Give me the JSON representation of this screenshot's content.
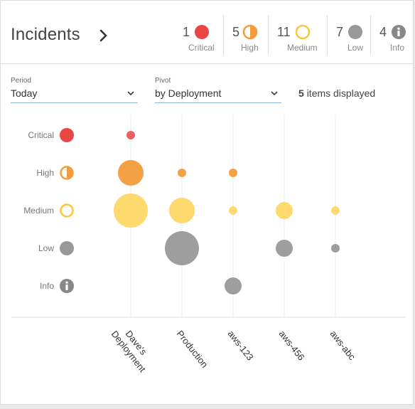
{
  "header": {
    "title": "Incidents",
    "counts": [
      {
        "key": "critical",
        "count": "1",
        "label": "Critical",
        "icon": "critical-icon"
      },
      {
        "key": "high",
        "count": "5",
        "label": "High",
        "icon": "high-icon"
      },
      {
        "key": "medium",
        "count": "11",
        "label": "Medium",
        "icon": "medium-icon"
      },
      {
        "key": "low",
        "count": "7",
        "label": "Low",
        "icon": "low-icon"
      },
      {
        "key": "info",
        "count": "4",
        "label": "Info",
        "icon": "info-icon"
      }
    ]
  },
  "controls": {
    "period": {
      "label": "Period",
      "value": "Today"
    },
    "pivot": {
      "label": "Pivot",
      "value": "by Deployment"
    },
    "items_count": "5",
    "items_text": "items displayed"
  },
  "colors": {
    "critical": "#e84545",
    "high": "#f39c3b",
    "medium": "#fdd766",
    "medium_ring": "#f7c93a",
    "low": "#999999",
    "info": "#888888",
    "divider": "#dcdcdc",
    "accent_line": "#8ab4d8"
  },
  "chart_data": {
    "type": "scatter",
    "rows": [
      "Critical",
      "High",
      "Medium",
      "Low",
      "Info"
    ],
    "categories": [
      "Dave's Deployment",
      "Production",
      "aws-123",
      "aws-456",
      "aws-abc"
    ],
    "points": [
      {
        "category": "Dave's Deployment",
        "severity": "Critical",
        "magnitude": 1
      },
      {
        "category": "Dave's Deployment",
        "severity": "High",
        "magnitude": 3
      },
      {
        "category": "Dave's Deployment",
        "severity": "Medium",
        "magnitude": 5
      },
      {
        "category": "Production",
        "severity": "High",
        "magnitude": 1
      },
      {
        "category": "Production",
        "severity": "Medium",
        "magnitude": 3
      },
      {
        "category": "Production",
        "severity": "Low",
        "magnitude": 5
      },
      {
        "category": "aws-123",
        "severity": "High",
        "magnitude": 1
      },
      {
        "category": "aws-123",
        "severity": "Medium",
        "magnitude": 1
      },
      {
        "category": "aws-123",
        "severity": "Info",
        "magnitude": 2
      },
      {
        "category": "aws-456",
        "severity": "Medium",
        "magnitude": 2
      },
      {
        "category": "aws-456",
        "severity": "Low",
        "magnitude": 2
      },
      {
        "category": "aws-abc",
        "severity": "Medium",
        "magnitude": 1
      },
      {
        "category": "aws-abc",
        "severity": "Low",
        "magnitude": 1
      }
    ]
  }
}
